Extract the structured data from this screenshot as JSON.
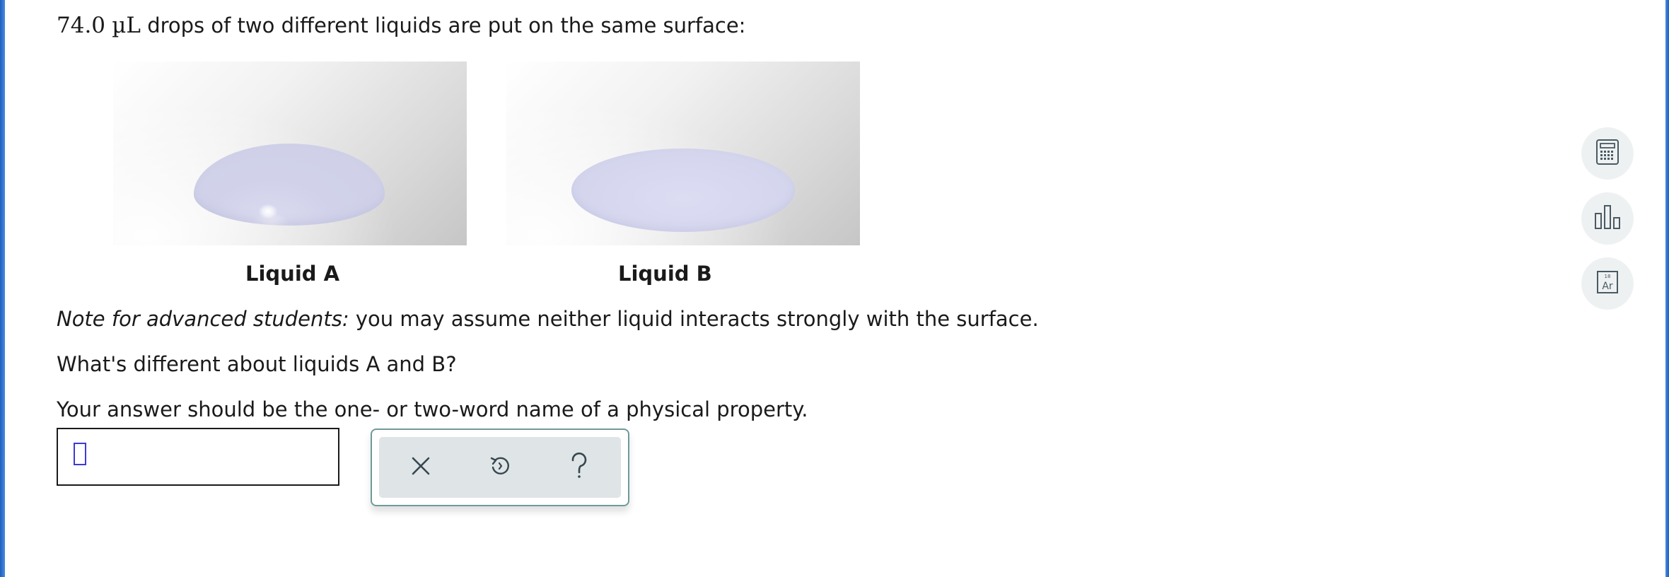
{
  "question": {
    "intro_value": "74.0",
    "intro_unit": "µL",
    "intro_rest": "drops of two different liquids are put on the same surface:",
    "note_label": "Note for advanced students:",
    "note_text": "you may assume neither liquid interacts strongly with the surface.",
    "prompt": "What's different about liquids A and B?",
    "instruction": "Your answer should be the one- or two-word name of a physical property."
  },
  "figures": [
    {
      "caption": "Liquid A"
    },
    {
      "caption": "Liquid B"
    }
  ],
  "answer": {
    "value": ""
  },
  "tools": {
    "clear_icon": "close-icon",
    "undo_icon": "undo-icon",
    "help_icon": "help-icon"
  },
  "sidebar": {
    "calculator_icon": "calculator-icon",
    "chart_icon": "bar-chart-icon",
    "periodic_table_icon": "periodic-table-icon",
    "periodic_number": "18",
    "periodic_symbol": "Ar"
  },
  "colors": {
    "frame": "#2a6cc9",
    "drop": "#d3d4ec",
    "accent": "#3b3bd6",
    "tool_border": "#6f9a9a"
  }
}
